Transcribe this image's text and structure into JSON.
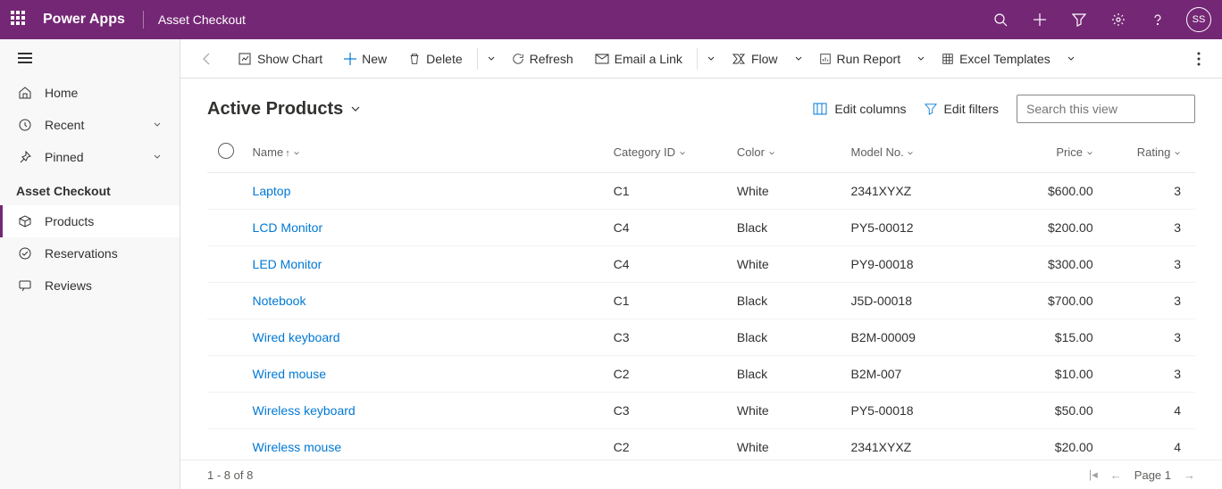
{
  "header": {
    "app_name": "Power Apps",
    "page_name": "Asset Checkout",
    "avatar_initials": "SS"
  },
  "sidebar": {
    "home": "Home",
    "recent": "Recent",
    "pinned": "Pinned",
    "section": "Asset Checkout",
    "items": [
      {
        "label": "Products"
      },
      {
        "label": "Reservations"
      },
      {
        "label": "Reviews"
      }
    ]
  },
  "commands": {
    "show_chart": "Show Chart",
    "new": "New",
    "delete": "Delete",
    "refresh": "Refresh",
    "email": "Email a Link",
    "flow": "Flow",
    "run_report": "Run Report",
    "excel": "Excel Templates"
  },
  "view": {
    "title": "Active Products",
    "edit_columns": "Edit columns",
    "edit_filters": "Edit filters",
    "search_placeholder": "Search this view"
  },
  "columns": {
    "name": "Name",
    "category": "Category ID",
    "color": "Color",
    "model": "Model No.",
    "price": "Price",
    "rating": "Rating"
  },
  "rows": [
    {
      "name": "Laptop",
      "category": "C1",
      "color": "White",
      "model": "2341XYXZ",
      "price": "$600.00",
      "rating": "3"
    },
    {
      "name": "LCD Monitor",
      "category": "C4",
      "color": "Black",
      "model": "PY5-00012",
      "price": "$200.00",
      "rating": "3"
    },
    {
      "name": "LED Monitor",
      "category": "C4",
      "color": "White",
      "model": "PY9-00018",
      "price": "$300.00",
      "rating": "3"
    },
    {
      "name": "Notebook",
      "category": "C1",
      "color": "Black",
      "model": "J5D-00018",
      "price": "$700.00",
      "rating": "3"
    },
    {
      "name": "Wired keyboard",
      "category": "C3",
      "color": "Black",
      "model": "B2M-00009",
      "price": "$15.00",
      "rating": "3"
    },
    {
      "name": "Wired mouse",
      "category": "C2",
      "color": "Black",
      "model": "B2M-007",
      "price": "$10.00",
      "rating": "3"
    },
    {
      "name": "Wireless keyboard",
      "category": "C3",
      "color": "White",
      "model": "PY5-00018",
      "price": "$50.00",
      "rating": "4"
    },
    {
      "name": "Wireless mouse",
      "category": "C2",
      "color": "White",
      "model": "2341XYXZ",
      "price": "$20.00",
      "rating": "4"
    }
  ],
  "footer": {
    "count": "1 - 8 of 8",
    "page": "Page 1"
  }
}
